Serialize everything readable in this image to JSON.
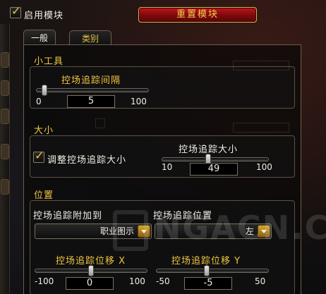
{
  "header": {
    "enable_label": "启用模块",
    "enable_checked": true,
    "reset_label": "重置模块"
  },
  "tabs": [
    {
      "label": "一般",
      "active": true
    },
    {
      "label": "类别",
      "active": false
    }
  ],
  "gadgets": {
    "title": "小工具",
    "interval": {
      "label": "控场追踪间隔",
      "min": "0",
      "max": "100",
      "value": "5",
      "level": 0.05
    }
  },
  "size": {
    "title": "大小",
    "adjust_label": "调整控场追踪大小",
    "adjust_checked": true,
    "slider": {
      "label": "控场追踪大小",
      "min": "10",
      "max": "100",
      "value": "49",
      "level": 0.43
    }
  },
  "position": {
    "title": "位置",
    "attach_label": "控场追踪附加到",
    "attach_value": "职业图示",
    "anchor_label": "控场追踪位置",
    "anchor_value": "左",
    "offset_x": {
      "label": "控场追踪位移 X",
      "min": "-100",
      "max": "100",
      "value": "0",
      "level": 0.5
    },
    "offset_y": {
      "label": "控场追踪位移 Y",
      "min": "-50",
      "max": "50",
      "value": "-5",
      "level": 0.45
    }
  },
  "colors": {
    "accent": "#f0c640",
    "reset_button": "#b01016"
  }
}
